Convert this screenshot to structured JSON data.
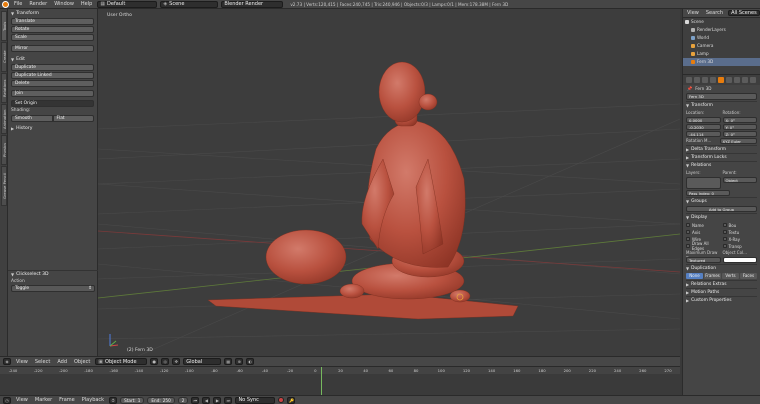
{
  "topbar": {
    "menus": [
      "File",
      "Render",
      "Window",
      "Help"
    ],
    "layout": "Default",
    "scene": "Scene",
    "engine": "Blender Render",
    "stats": "v2.73 | Verts:120,415 | Faces:240,745 | Tris:240,946 | Objects:0/3 | Lamps:0/1 | Mem:178.38M | Fern 3D"
  },
  "tool_tabs": [
    "Tools",
    "Create",
    "Relations",
    "Animation",
    "Physics",
    "Grease Pencil"
  ],
  "shelf": {
    "transform_header": "Transform",
    "transform_buttons": [
      "Translate",
      "Rotate",
      "Scale"
    ],
    "mirror": "Mirror",
    "edit_header": "Edit",
    "edit_buttons": [
      "Duplicate",
      "Duplicate Linked",
      "Delete",
      "Join"
    ],
    "set_origin": "Set Origin",
    "shading_label": "Shading:",
    "shading_smooth": "Smooth",
    "shading_flat": "Flat",
    "history_header": "History",
    "operator_header": "Clickselect 3D",
    "action_label": "Action",
    "action_value": "Toggle"
  },
  "viewport": {
    "view_label": "User Ortho",
    "object_label": "(2) Fern 3D"
  },
  "vp_header": {
    "items": [
      "View",
      "Select",
      "Add",
      "Object"
    ],
    "mode": "Object Mode",
    "pivot": "Global"
  },
  "timeline": {
    "ticks": [
      "-240",
      "-220",
      "-200",
      "-180",
      "-160",
      "-140",
      "-120",
      "-100",
      "-80",
      "-60",
      "-40",
      "-20",
      "0",
      "20",
      "40",
      "60",
      "80",
      "100",
      "120",
      "140",
      "160",
      "180",
      "200",
      "220",
      "240",
      "260",
      "270"
    ],
    "current_frame_value": 0
  },
  "tl_header": {
    "items": [
      "View",
      "Marker",
      "Frame",
      "Playback"
    ],
    "start_label": "Start:",
    "start_value": "1",
    "end_label": "End:",
    "end_value": "250",
    "current": "2",
    "sync": "No Sync"
  },
  "outliner": {
    "view": "View",
    "search": "Search",
    "scenes": "All Scenes",
    "items": [
      {
        "label": "Scene",
        "color": "#d9d9d9"
      },
      {
        "label": "RenderLayers",
        "color": "#b3b3b3"
      },
      {
        "label": "World",
        "color": "#7da1c8"
      },
      {
        "label": "Camera",
        "color": "#e8a23c"
      },
      {
        "label": "Lamp",
        "color": "#e8a23c"
      },
      {
        "label": "Fern 3D",
        "color": "#e87d0d"
      }
    ]
  },
  "properties": {
    "breadcrumb": "Fern 3D",
    "object_name": "Fern 3D",
    "transform_header": "Transform",
    "location_label": "Location:",
    "rotation_label": "Rotation:",
    "location": [
      "0.0000",
      "-0.2030",
      "-44.114"
    ],
    "rotation": [
      "X: 0°",
      "Y: 0°",
      "Z: 0°"
    ],
    "rotation_mode_label": "Rotation M...",
    "rotation_mode": "XYZ Euler",
    "delta_header": "Delta Transform",
    "locks_header": "Transform Locks",
    "relations_header": "Relations",
    "layers_label": "Layers:",
    "parent_label": "Parent:",
    "parent_type": "Object",
    "pass_index": "Pass Index: 0",
    "groups_header": "Groups",
    "add_group": "Add to Group",
    "display_header": "Display",
    "display_checks": [
      "Name",
      "Axis",
      "Wire",
      "Draw All Edges",
      "Bou",
      "Textu",
      "X-Ray",
      "Transp"
    ],
    "max_draw_label": "Maximum Draw Ty...",
    "object_color_label": "Object Col...",
    "max_draw_value": "Textured",
    "duplication_header": "Duplication",
    "dup_tabs": [
      "None",
      "Frames",
      "Verts",
      "Faces"
    ],
    "more_headers": [
      "Relations Extras",
      "Motion Paths",
      "Custom Properties"
    ]
  }
}
